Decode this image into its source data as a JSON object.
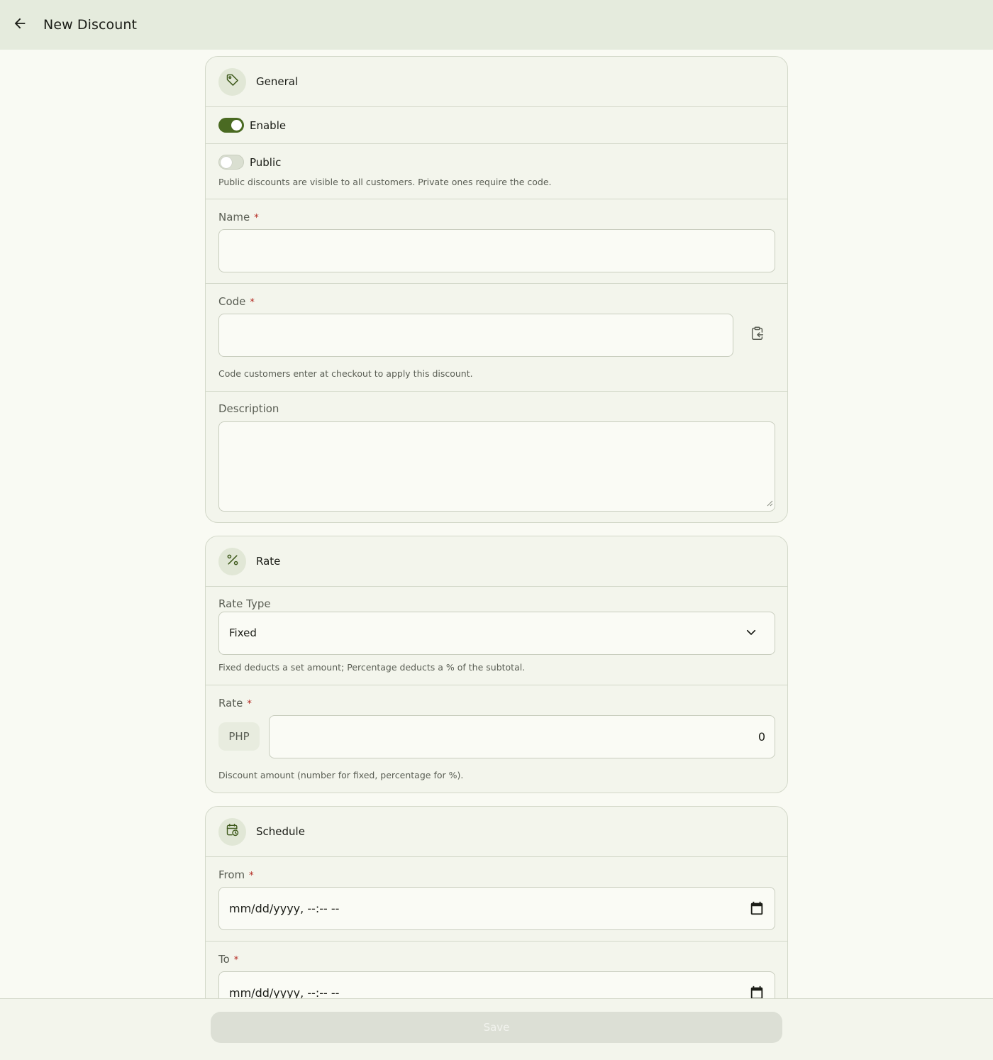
{
  "header": {
    "title": "New Discount",
    "back_icon": "arrow-left-icon"
  },
  "general": {
    "title": "General",
    "icon": "tag-icon",
    "enable": {
      "label": "Enable",
      "on": true
    },
    "public": {
      "label": "Public",
      "on": false,
      "help": "Public discounts are visible to all customers. Private ones require the code."
    },
    "name": {
      "label": "Name",
      "required": "*",
      "value": ""
    },
    "code": {
      "label": "Code",
      "required": "*",
      "value": "",
      "action_icon": "clipboard-paste-icon",
      "help": "Code customers enter at checkout to apply this discount."
    },
    "description": {
      "label": "Description",
      "value": ""
    }
  },
  "rate_section": {
    "title": "Rate",
    "icon": "percent-icon",
    "rate_type": {
      "label": "Rate Type",
      "value": "Fixed",
      "help": "Fixed deducts a set amount; Percentage deducts a % of the subtotal."
    },
    "rate": {
      "label": "Rate",
      "required": "*",
      "prefix": "PHP",
      "value": "0",
      "help": "Discount amount (number for fixed, percentage for %)."
    }
  },
  "schedule": {
    "title": "Schedule",
    "icon": "calendar-clock-icon",
    "from": {
      "label": "From",
      "required": "*",
      "placeholder": "mm/dd/yyyy, --:-- --"
    },
    "to": {
      "label": "To",
      "required": "*",
      "placeholder": "mm/dd/yyyy, --:-- --"
    }
  },
  "footer": {
    "save_label": "Save"
  },
  "colors": {
    "accent": "#4a6a22",
    "topbar": "#e5ebdd",
    "card": "#f3f5ec",
    "required": "#b3261e"
  }
}
